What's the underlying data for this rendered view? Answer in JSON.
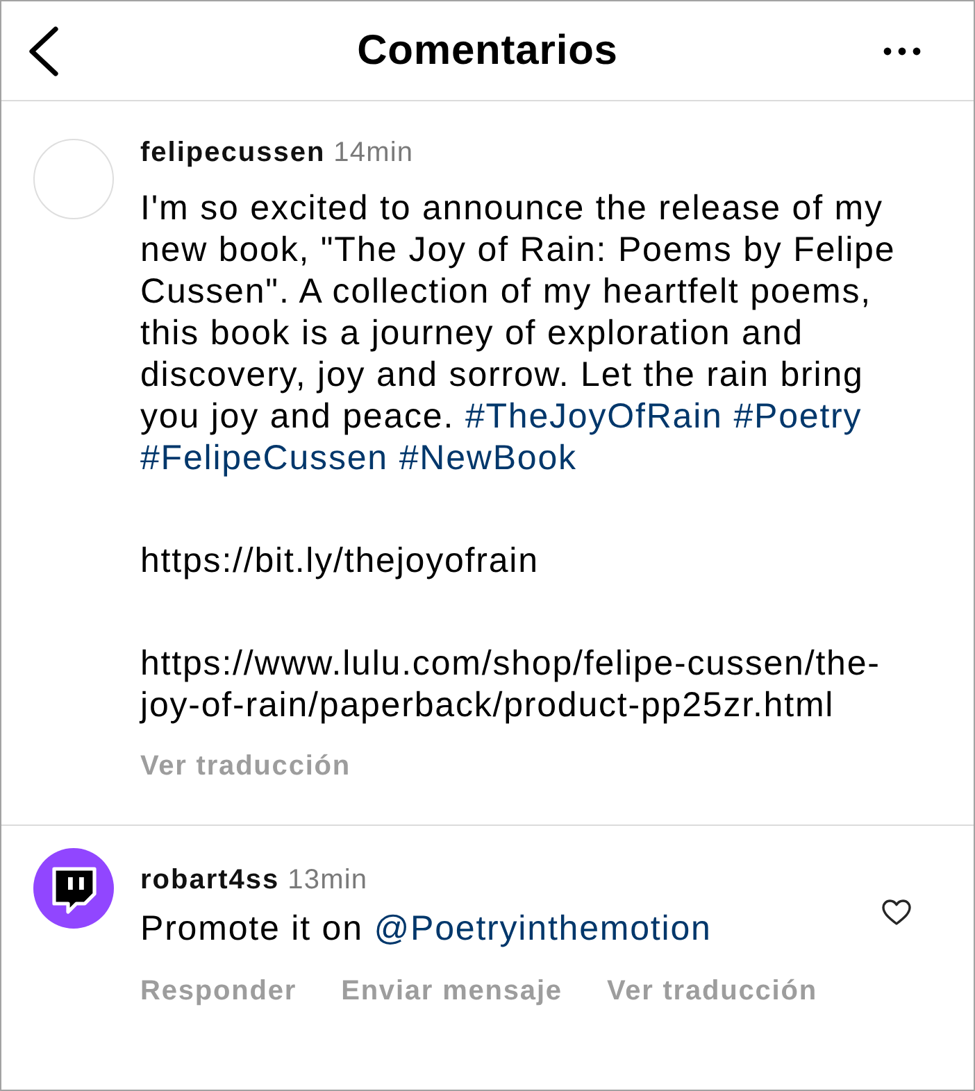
{
  "header": {
    "title": "Comentarios"
  },
  "caption": {
    "username": "felipecussen",
    "time": "14min",
    "paragraphs": [
      [
        {
          "kind": "text",
          "text": "I'm so excited to announce the release of my new book, \"The Joy of Rain: Poems by Felipe Cussen\". A collection of my heartfelt poems, this book is a journey of exploration and discovery, joy and sorrow. Let the rain bring you joy and peace."
        },
        {
          "kind": "hashtag",
          "text": "#TheJoyOfRain"
        },
        {
          "kind": "hashtag",
          "text": "#Poetry"
        },
        {
          "kind": "hashtag",
          "text": "#FelipeCussen"
        },
        {
          "kind": "hashtag",
          "text": "#NewBook"
        }
      ],
      [
        {
          "kind": "text",
          "text": "https://bit.ly/thejoyofrain"
        }
      ],
      [
        {
          "kind": "text",
          "text": "https://www.lulu.com/shop/felipe-cussen/the-joy-of-rain/paperback/product-pp25zr.html"
        }
      ]
    ],
    "actions": [
      "Ver traducción"
    ]
  },
  "comments": [
    {
      "username": "robart4ss",
      "time": "13min",
      "paragraphs": [
        [
          {
            "kind": "text",
            "text": "Promote it on"
          },
          {
            "kind": "mention",
            "text": "@Poetryinthemotion"
          }
        ]
      ],
      "actions": [
        "Responder",
        "Enviar mensaje",
        "Ver traducción"
      ],
      "liked": false
    }
  ]
}
